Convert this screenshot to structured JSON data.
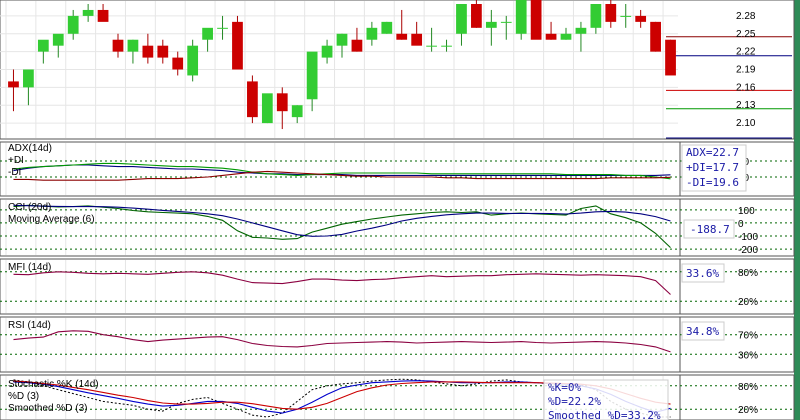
{
  "chart_data": [
    {
      "type": "candlestick",
      "ylim": [
        2.08,
        2.3
      ],
      "ticks": [
        "2.28",
        "2.25",
        "2.22",
        "2.19",
        "2.16",
        "2.13",
        "2.10"
      ],
      "tick_values": [
        2.28,
        2.25,
        2.22,
        2.19,
        2.16,
        2.13,
        2.1
      ],
      "candles": [
        [
          2.17,
          2.19,
          2.12,
          2.16
        ],
        [
          2.16,
          2.18,
          2.13,
          2.19
        ],
        [
          2.22,
          2.23,
          2.2,
          2.24
        ],
        [
          2.23,
          2.24,
          2.21,
          2.25
        ],
        [
          2.25,
          2.29,
          2.24,
          2.28
        ],
        [
          2.28,
          2.3,
          2.27,
          2.29
        ],
        [
          2.29,
          2.3,
          2.28,
          2.27
        ],
        [
          2.24,
          2.25,
          2.21,
          2.22
        ],
        [
          2.22,
          2.24,
          2.2,
          2.24
        ],
        [
          2.23,
          2.25,
          2.2,
          2.21
        ],
        [
          2.23,
          2.24,
          2.2,
          2.21
        ],
        [
          2.21,
          2.22,
          2.18,
          2.19
        ],
        [
          2.18,
          2.24,
          2.17,
          2.23
        ],
        [
          2.24,
          2.25,
          2.22,
          2.26
        ],
        [
          2.26,
          2.28,
          2.24,
          2.26
        ],
        [
          2.27,
          2.28,
          2.24,
          2.19
        ],
        [
          2.17,
          2.18,
          2.1,
          2.11
        ],
        [
          2.1,
          2.14,
          2.1,
          2.15
        ],
        [
          2.15,
          2.16,
          2.09,
          2.12
        ],
        [
          2.11,
          2.13,
          2.1,
          2.13
        ],
        [
          2.14,
          2.19,
          2.12,
          2.22
        ],
        [
          2.21,
          2.24,
          2.2,
          2.23
        ],
        [
          2.23,
          2.25,
          2.21,
          2.25
        ],
        [
          2.24,
          2.26,
          2.22,
          2.22
        ],
        [
          2.24,
          2.27,
          2.23,
          2.26
        ],
        [
          2.25,
          2.27,
          2.25,
          2.27
        ],
        [
          2.25,
          2.29,
          2.24,
          2.24
        ],
        [
          2.25,
          2.27,
          2.24,
          2.23
        ],
        [
          2.23,
          2.26,
          2.22,
          2.23
        ],
        [
          2.23,
          2.24,
          2.22,
          2.23
        ],
        [
          2.25,
          2.3,
          2.23,
          2.3
        ],
        [
          2.3,
          2.31,
          2.26,
          2.26
        ],
        [
          2.26,
          2.29,
          2.23,
          2.27
        ],
        [
          2.27,
          2.28,
          2.24,
          2.27
        ],
        [
          2.25,
          2.3,
          2.24,
          2.31
        ],
        [
          2.31,
          2.31,
          2.25,
          2.24
        ],
        [
          2.25,
          2.27,
          2.24,
          2.24
        ],
        [
          2.24,
          2.26,
          2.24,
          2.25
        ],
        [
          2.25,
          2.27,
          2.22,
          2.26
        ],
        [
          2.26,
          2.3,
          2.25,
          2.3
        ],
        [
          2.3,
          2.31,
          2.26,
          2.27
        ],
        [
          2.28,
          2.3,
          2.26,
          2.28
        ],
        [
          2.28,
          2.29,
          2.26,
          2.27
        ],
        [
          2.27,
          2.27,
          2.22,
          2.22
        ],
        [
          2.24,
          2.24,
          2.19,
          2.18
        ]
      ],
      "hlines": [
        {
          "value": 2.245,
          "color": "#8b0000"
        },
        {
          "value": 2.213,
          "color": "#000080"
        },
        {
          "value": 2.155,
          "color": "#cc0000"
        },
        {
          "value": 2.124,
          "color": "#009900"
        },
        {
          "value": 2.075,
          "color": "#000080"
        }
      ]
    },
    {
      "type": "line",
      "title": "ADX(14d)",
      "legend": [
        "+DI",
        "-DI"
      ],
      "ticks": [
        "40",
        "20"
      ],
      "ylim": [
        0,
        60
      ],
      "series": [
        {
          "name": "ADX",
          "color": "#000080",
          "values": [
            28,
            31,
            33,
            34,
            35,
            35,
            34,
            33,
            33,
            32,
            31,
            30,
            30,
            29,
            28,
            26,
            25,
            24,
            24,
            23,
            23,
            23,
            23,
            22,
            22,
            22,
            22,
            22,
            22,
            22,
            22,
            22,
            22,
            22,
            22,
            22,
            22,
            22,
            22,
            22,
            22,
            22,
            22,
            22,
            22.7
          ]
        },
        {
          "name": "+DI",
          "color": "#009900",
          "values": [
            30,
            32,
            33,
            34,
            35,
            36,
            37,
            37,
            36,
            35,
            34,
            33,
            33,
            32,
            31,
            29,
            26,
            24,
            23,
            22,
            23,
            24,
            25,
            25,
            25,
            25,
            25,
            25,
            24,
            24,
            24,
            24,
            24,
            24,
            24,
            24,
            24,
            23,
            23,
            23,
            23,
            22,
            22,
            20,
            17.7
          ]
        },
        {
          "name": "-DI",
          "color": "#8b0000",
          "values": [
            17,
            17,
            16,
            16,
            16,
            16,
            16,
            16,
            17,
            18,
            18,
            18,
            19,
            20,
            22,
            24,
            26,
            27,
            26,
            25,
            24,
            23,
            22,
            21,
            21,
            20,
            20,
            20,
            20,
            19,
            19,
            18,
            18,
            18,
            18,
            18,
            18,
            18,
            18,
            18,
            19,
            19,
            19,
            19,
            19.6
          ]
        }
      ],
      "callouts": [
        "ADX=22.7",
        "+DI=17.7",
        "-DI=19.6"
      ]
    },
    {
      "type": "line",
      "title": "CCI (20d)",
      "legend": [
        "Moving Average (6)"
      ],
      "ticks": [
        "100",
        "0",
        "-100",
        "-200"
      ],
      "ylim": [
        -230,
        160
      ],
      "series": [
        {
          "name": "CCI",
          "color": "#006400",
          "values": [
            125,
            135,
            128,
            122,
            125,
            130,
            120,
            110,
            95,
            85,
            80,
            75,
            70,
            50,
            20,
            -60,
            -110,
            -115,
            -125,
            -120,
            -70,
            -40,
            -10,
            10,
            30,
            45,
            60,
            70,
            80,
            85,
            80,
            85,
            60,
            70,
            75,
            70,
            65,
            60,
            110,
            130,
            70,
            40,
            0,
            -80,
            -188.7
          ]
        },
        {
          "name": "Moving Average",
          "color": "#000080",
          "values": [
            135,
            132,
            128,
            126,
            125,
            125,
            124,
            120,
            113,
            105,
            96,
            88,
            80,
            70,
            55,
            30,
            0,
            -30,
            -60,
            -90,
            -102,
            -100,
            -88,
            -62,
            -40,
            -15,
            15,
            35,
            50,
            62,
            70,
            75,
            75,
            73,
            72,
            73,
            72,
            68,
            75,
            85,
            88,
            83,
            70,
            48,
            15
          ]
        }
      ],
      "callouts": [
        "-188.7"
      ]
    },
    {
      "type": "line",
      "title": "MFI (14d)",
      "ticks": [
        "80%",
        "20%"
      ],
      "ylim": [
        0,
        100
      ],
      "series": [
        {
          "name": "MFI",
          "color": "#8b0040",
          "values": [
            75,
            74,
            78,
            80,
            79,
            77,
            76,
            77,
            76,
            75,
            77,
            79,
            80,
            78,
            73,
            65,
            58,
            57,
            56,
            60,
            65,
            65,
            63,
            62,
            64,
            65,
            68,
            70,
            72,
            70,
            71,
            72,
            72,
            74,
            75,
            76,
            75,
            74,
            73,
            74,
            73,
            72,
            70,
            62,
            33.6
          ]
        }
      ],
      "callouts": [
        "33.6%"
      ]
    },
    {
      "type": "line",
      "title": "RSI (14d)",
      "ticks": [
        "70%",
        "30%"
      ],
      "ylim": [
        0,
        100
      ],
      "series": [
        {
          "name": "RSI",
          "color": "#8b0040",
          "values": [
            60,
            63,
            65,
            76,
            78,
            77,
            70,
            66,
            60,
            56,
            59,
            61,
            63,
            65,
            66,
            60,
            52,
            48,
            46,
            45,
            48,
            52,
            53,
            54,
            55,
            56,
            55,
            53,
            54,
            55,
            56,
            55,
            54,
            55,
            56,
            54,
            53,
            54,
            55,
            56,
            55,
            53,
            50,
            45,
            34.8
          ]
        }
      ],
      "callouts": [
        "34.8%"
      ]
    },
    {
      "type": "line",
      "title": "Stochastic %K (14d)",
      "legend": [
        "%D (3)",
        "Smoothed %D (3)"
      ],
      "ticks": [
        "80%",
        "20%"
      ],
      "ylim": [
        0,
        100
      ],
      "series": [
        {
          "name": "%K",
          "color": "#000000",
          "dashed": true,
          "values": [
            95,
            90,
            80,
            70,
            60,
            50,
            40,
            35,
            30,
            20,
            15,
            35,
            45,
            50,
            35,
            20,
            5,
            0,
            10,
            40,
            70,
            80,
            85,
            88,
            92,
            95,
            97,
            95,
            90,
            85,
            80,
            85,
            92,
            95,
            90,
            88,
            85,
            80,
            82,
            70,
            40,
            20,
            10,
            0,
            0
          ]
        },
        {
          "name": "%D",
          "color": "#0000cc",
          "values": [
            90,
            88,
            84,
            78,
            70,
            62,
            55,
            48,
            40,
            33,
            28,
            30,
            35,
            40,
            40,
            35,
            25,
            15,
            10,
            20,
            38,
            58,
            75,
            82,
            88,
            90,
            92,
            93,
            92,
            90,
            88,
            88,
            88,
            90,
            90,
            88,
            86,
            84,
            80,
            72,
            58,
            40,
            25,
            12,
            22.2
          ]
        },
        {
          "name": "Smoothed %D",
          "color": "#cc0000",
          "values": [
            92,
            90,
            86,
            82,
            76,
            70,
            63,
            56,
            50,
            42,
            36,
            33,
            33,
            35,
            38,
            38,
            34,
            28,
            22,
            20,
            25,
            35,
            50,
            65,
            75,
            82,
            86,
            88,
            90,
            90,
            90,
            89,
            88,
            88,
            88,
            88,
            87,
            86,
            84,
            80,
            72,
            60,
            48,
            38,
            33.2
          ]
        }
      ],
      "callouts": [
        "%K=0%",
        "%D=22.2%",
        "Smoothed %D=33.2%"
      ]
    }
  ],
  "colors": {
    "frame": "#2e8b57",
    "up": "#33cc33",
    "down": "#cc0000",
    "grid": "#e6e6e6"
  }
}
